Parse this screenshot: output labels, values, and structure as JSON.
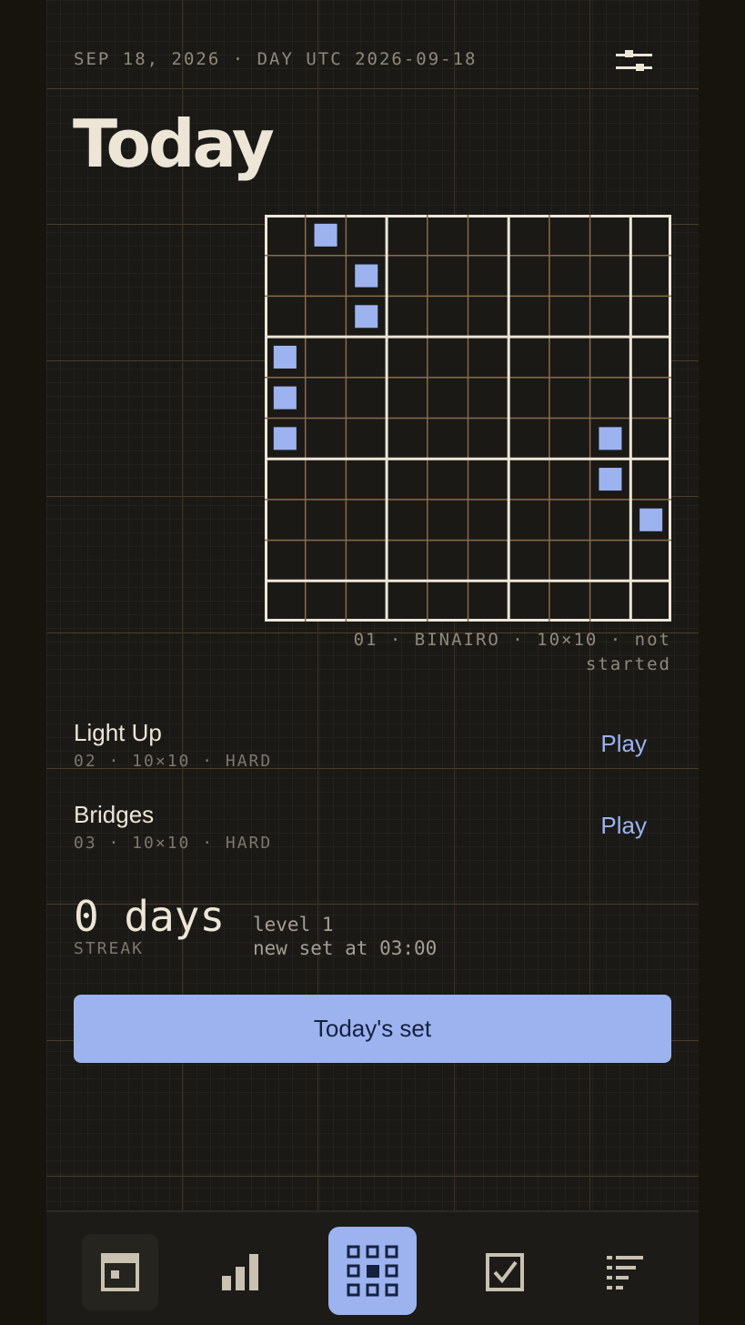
{
  "header": {
    "date_line": "SEP 18, 2026 · DAY UTC 2026-09-18",
    "settings_icon": "sliders-icon"
  },
  "page_title": "Today",
  "board": {
    "size": 10,
    "block_size": 3,
    "filled_cells": [
      [
        0,
        1
      ],
      [
        1,
        2
      ],
      [
        2,
        2
      ],
      [
        3,
        0
      ],
      [
        4,
        0
      ],
      [
        5,
        0
      ],
      [
        5,
        8
      ],
      [
        6,
        8
      ],
      [
        7,
        9
      ]
    ],
    "colors": {
      "line": "#ede6d7",
      "minor_line": "#8a6b4a",
      "cell_fill": "#9cb3f0"
    },
    "caption": "01 · BINAIRO · 10×10 · not started"
  },
  "puzzles": [
    {
      "name": "Light Up",
      "meta": "02 · 10×10 · HARD",
      "action": "Play"
    },
    {
      "name": "Bridges",
      "meta": "03 · 10×10 · HARD",
      "action": "Play"
    }
  ],
  "streak": {
    "value": "0 days",
    "label": "STREAK",
    "level": "level 1",
    "next_set": "new set at 03:00"
  },
  "cta_label": "Today's set",
  "nav": [
    {
      "icon": "calendar-icon",
      "state": "selected"
    },
    {
      "icon": "stats-bars-icon",
      "state": "normal"
    },
    {
      "icon": "puzzle-grid-icon",
      "state": "active"
    },
    {
      "icon": "checkbox-icon",
      "state": "normal"
    },
    {
      "icon": "list-icon",
      "state": "normal"
    }
  ],
  "colors": {
    "accent": "#9cb3f0",
    "text": "#ede6d7",
    "muted": "#8f897c",
    "background": "#1a1916"
  }
}
